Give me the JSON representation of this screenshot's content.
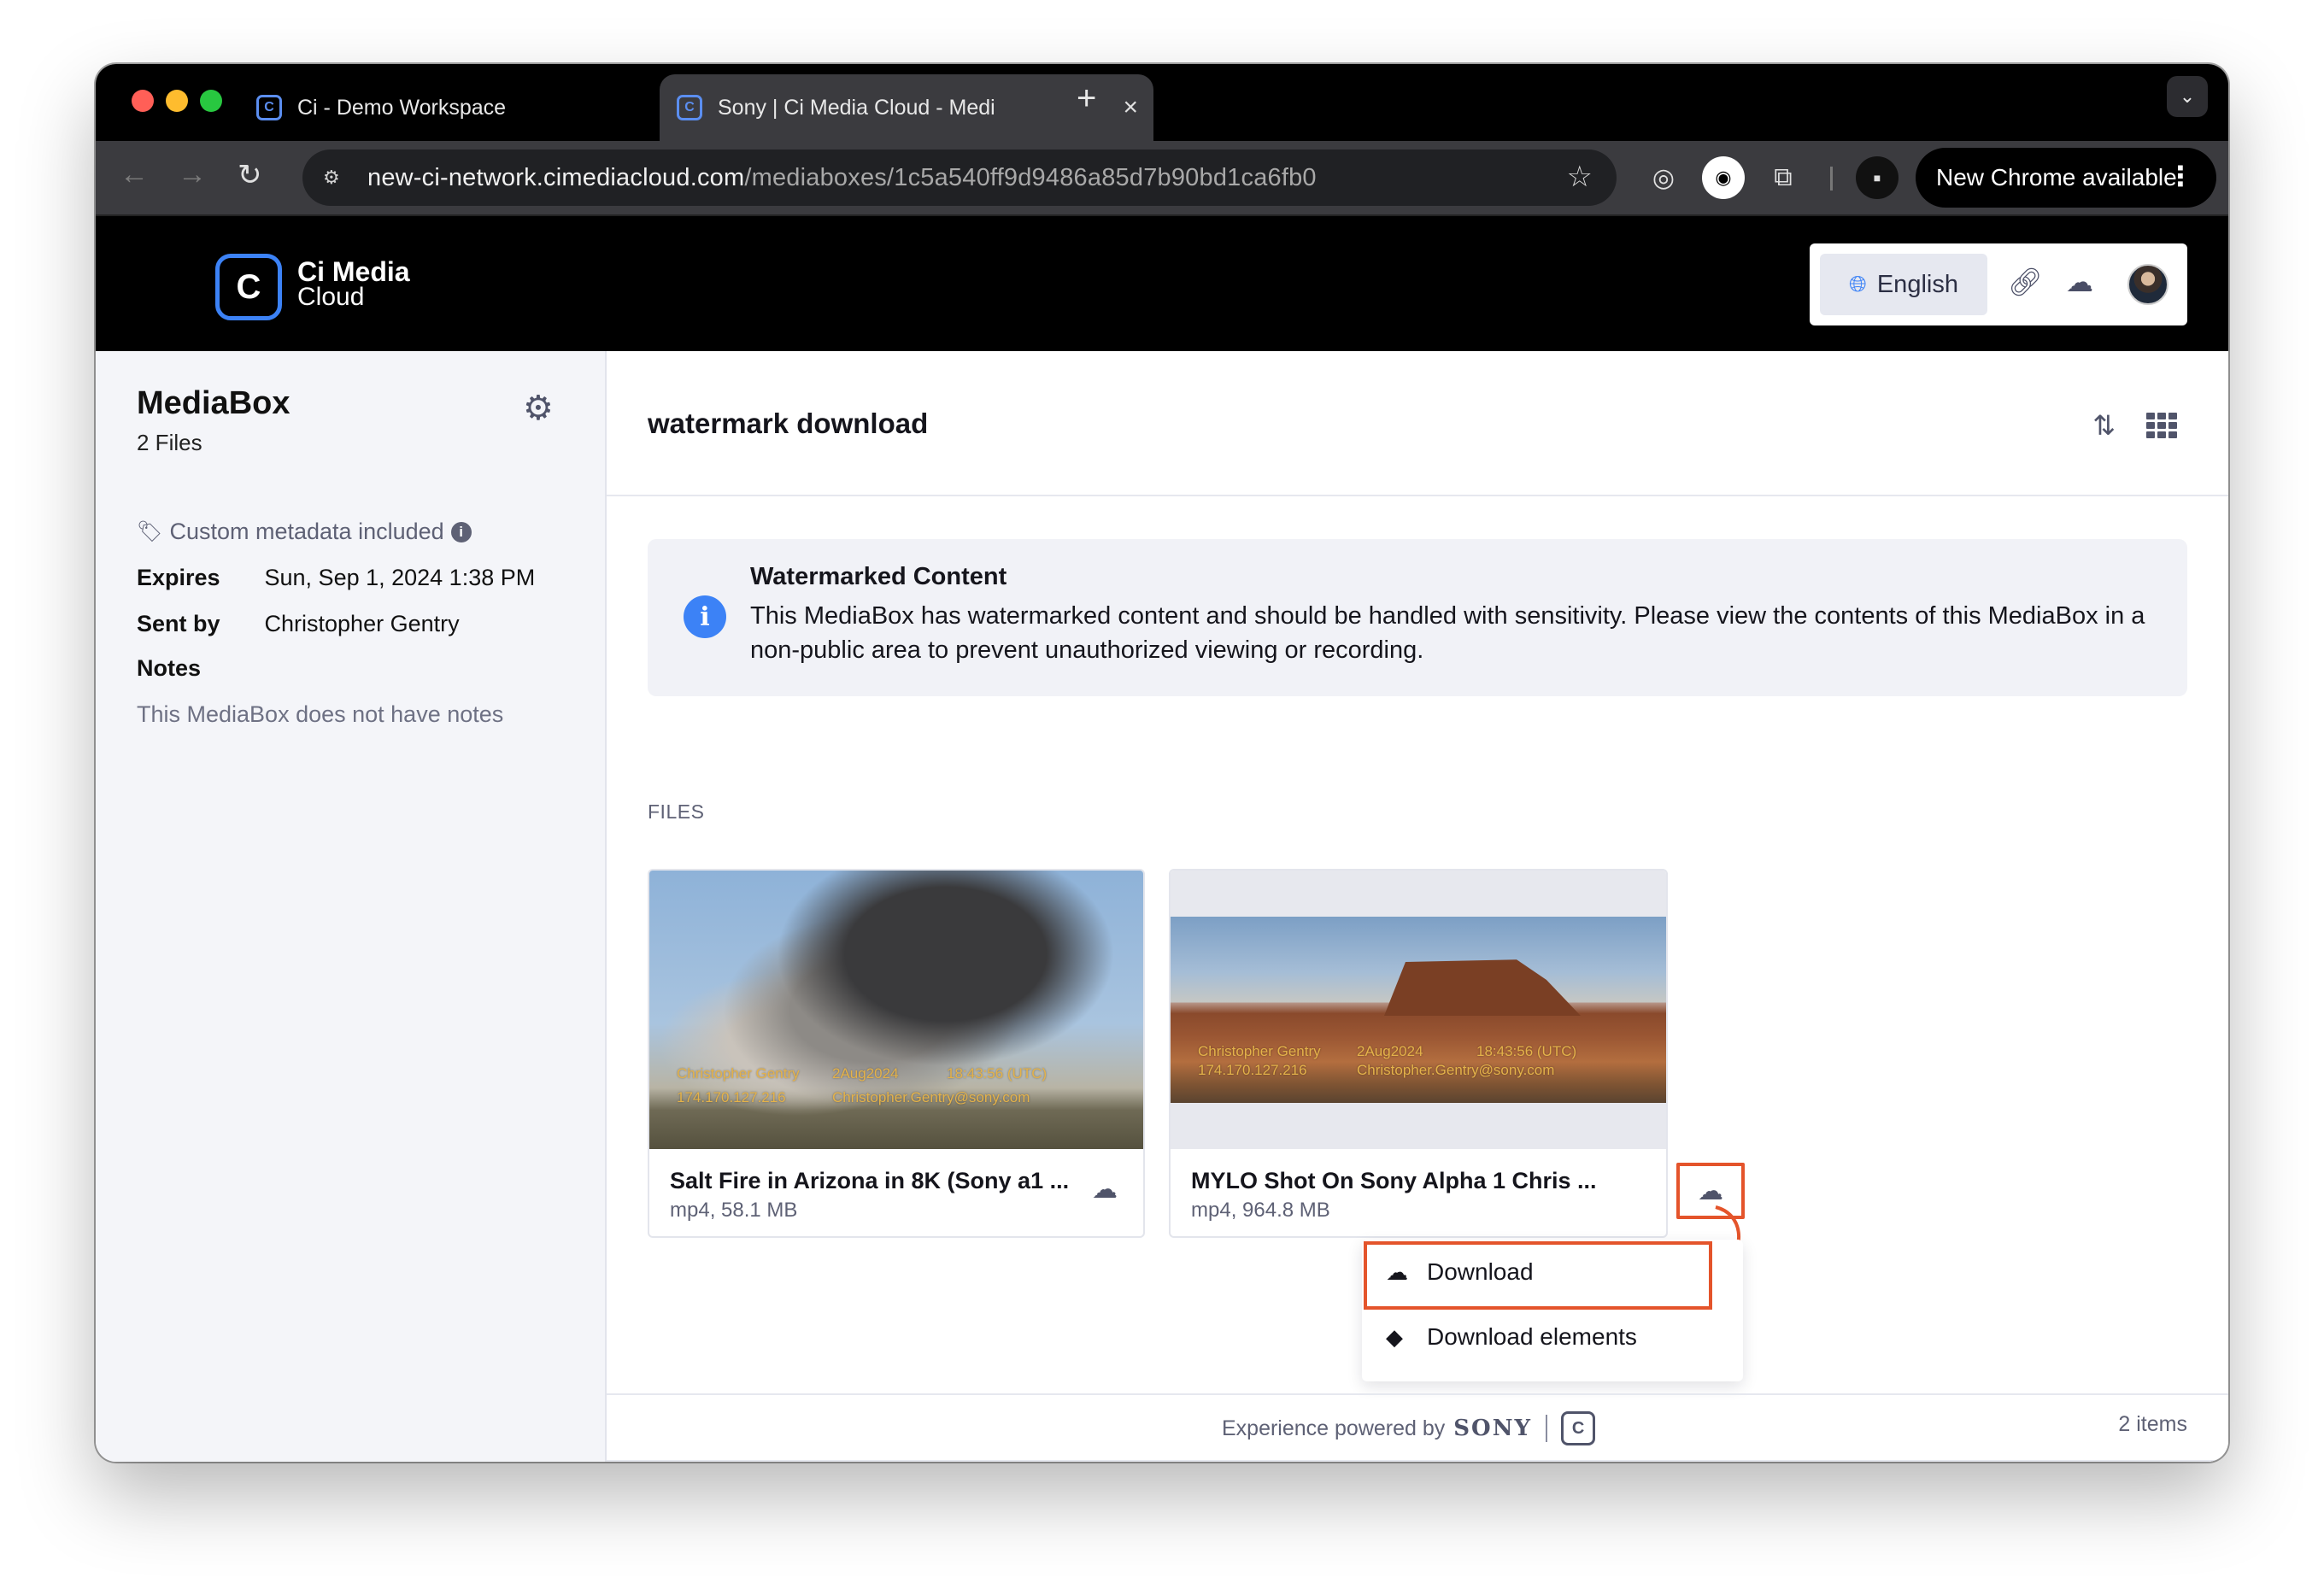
{
  "browser": {
    "tabs": [
      {
        "title": "Ci - Demo Workspace",
        "close": "×"
      },
      {
        "title": "Sony | Ci Media Cloud - Medi",
        "close": "×"
      }
    ],
    "new_tab": "+",
    "url_host": "new-ci-network.cimediacloud.com",
    "url_path": "/mediaboxes/1c5a540ff9d9486a85d7b90bd1ca6fb0",
    "new_chrome": "New Chrome available"
  },
  "header": {
    "logo_line1": "Ci Media",
    "logo_line2": "Cloud",
    "language": "English"
  },
  "sidebar": {
    "title": "MediaBox",
    "file_count": "2 Files",
    "metadata_note": "Custom metadata included",
    "expires_label": "Expires",
    "expires_value": "Sun, Sep 1, 2024 1:38 PM",
    "sent_label": "Sent by",
    "sent_value": "Christopher Gentry",
    "notes_label": "Notes",
    "notes_empty": "This MediaBox does not have notes"
  },
  "main": {
    "title": "watermark download",
    "alert_title": "Watermarked Content",
    "alert_body": "This MediaBox has watermarked content and should be handled with sensitivity. Please view the contents of this MediaBox in a non-public area to prevent unauthorized viewing or recording.",
    "files_label": "FILES",
    "files": [
      {
        "name": "Salt Fire in Arizona in 8K (Sony a1 ...",
        "meta": "mp4, 58.1 MB",
        "watermark": [
          "Christopher Gentry",
          "2Aug2024",
          "18:43:56 (UTC)",
          "174.170.127.216",
          "Christopher.Gentry@sony.com"
        ]
      },
      {
        "name": "MYLO Shot On Sony Alpha 1 Chris ...",
        "meta": "mp4, 964.8 MB",
        "watermark": [
          "Christopher Gentry",
          "2Aug2024",
          "18:43:56 (UTC)",
          "174.170.127.216",
          "Christopher.Gentry@sony.com"
        ]
      }
    ],
    "menu": {
      "download": "Download",
      "download_elements": "Download elements"
    },
    "items_count": "2 items"
  },
  "footer": {
    "powered_by": "Experience powered by",
    "brand": "SONY"
  },
  "colors": {
    "accent": "#3c82f6",
    "highlight": "#e4542b"
  }
}
